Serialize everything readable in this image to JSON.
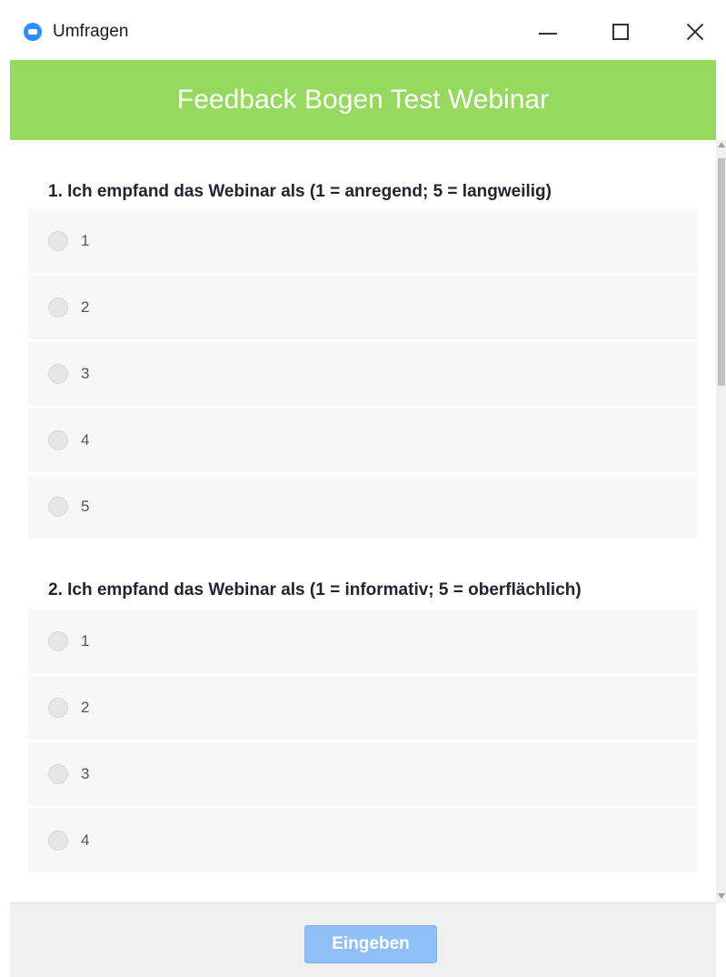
{
  "window": {
    "title": "Umfragen",
    "app_icon": "zoom-icon",
    "controls": [
      "minimize-icon",
      "maximize-icon",
      "close-icon"
    ]
  },
  "header": {
    "title": "Feedback Bogen Test Webinar",
    "background_color": "#95d95f"
  },
  "questions": [
    {
      "title": "1. Ich empfand das Webinar als (1 = anregend; 5 = langweilig)",
      "options": [
        "1",
        "2",
        "3",
        "4",
        "5"
      ]
    },
    {
      "title": "2. Ich empfand das Webinar als (1 = informativ; 5 = oberflächlich)",
      "options": [
        "1",
        "2",
        "3",
        "4"
      ]
    }
  ],
  "footer": {
    "submit_label": "Eingeben",
    "submit_color": "#8fbff5"
  }
}
